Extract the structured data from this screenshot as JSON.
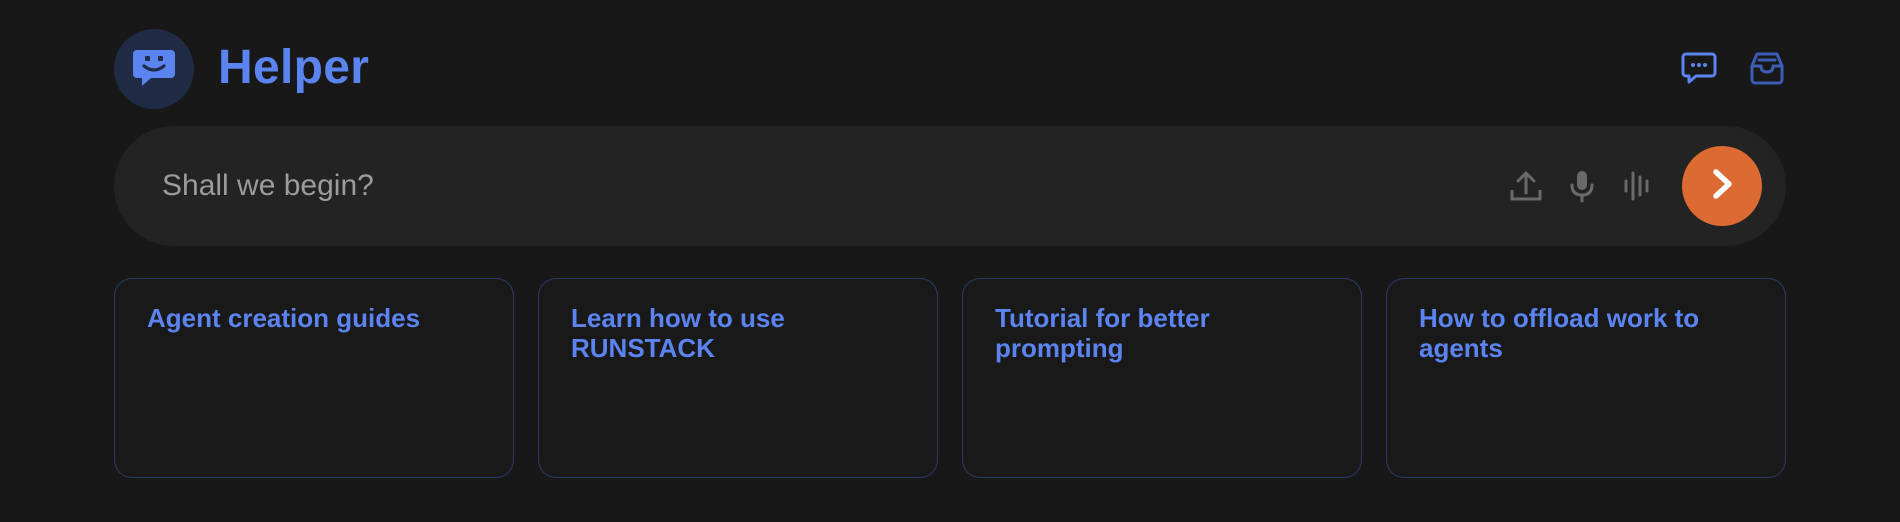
{
  "header": {
    "title": "Helper",
    "avatar_icon": "chat-bot-icon",
    "actions": [
      {
        "name": "chat-icon"
      },
      {
        "name": "inbox-icon"
      }
    ]
  },
  "prompt": {
    "placeholder": "Shall we begin?",
    "tools": [
      "upload-icon",
      "microphone-icon",
      "waveform-icon"
    ],
    "send_icon": "chevron-right-icon"
  },
  "suggestions": [
    {
      "label": "Agent creation guides"
    },
    {
      "label": "Learn how to use RUNSTACK"
    },
    {
      "label": "Tutorial for better prompting"
    },
    {
      "label": "How to offload work to agents"
    }
  ],
  "colors": {
    "background": "#181818",
    "accent": "#5b84f0",
    "send": "#db6a33",
    "card_border": "#2b3a63"
  }
}
